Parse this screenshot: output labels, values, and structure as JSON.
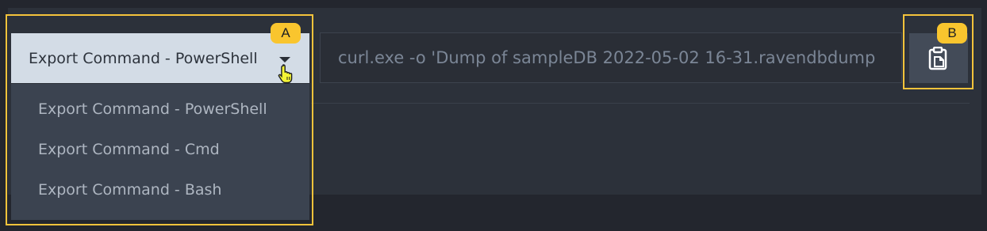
{
  "export_dropdown": {
    "selected_label": "Export Command - PowerShell",
    "options": [
      "Export Command - PowerShell",
      "Export Command - Cmd",
      "Export Command - Bash"
    ]
  },
  "command_field": {
    "value": "curl.exe -o 'Dump of sampleDB 2022-05-02 16-31.ravendbdump"
  },
  "copy_button": {
    "icon": "clipboard-copy-icon"
  },
  "annotations": {
    "badge_a": "A",
    "badge_b": "B",
    "highlight_color": "#f5c33b"
  }
}
